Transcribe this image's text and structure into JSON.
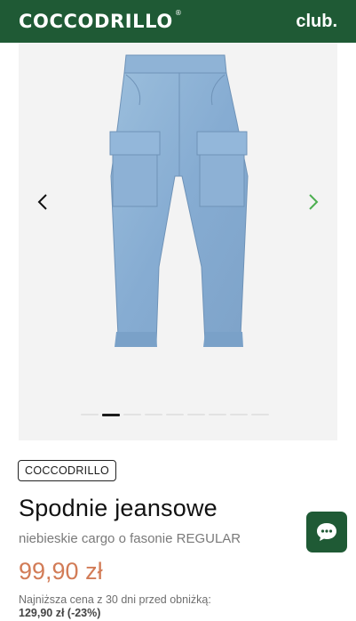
{
  "header": {
    "logo": "COCCODRILLO",
    "logo_mark": "®",
    "club": "club."
  },
  "gallery": {
    "slide_count": 9,
    "active_index": 1
  },
  "product": {
    "brand": "COCCODRILLO",
    "title": "Spodnie jeansowe",
    "subtitle": "niebieskie cargo o fasonie REGULAR",
    "price": "99,90 zł",
    "lowest_price_label": "Najniższa cena z 30 dni przed obniżką:",
    "lowest_price_value": "129,90 zł (-23%)"
  },
  "colors": {
    "brand_green": "#1f5a35",
    "price": "#d27c57",
    "arrow_right": "#4caf50"
  },
  "icons": {
    "prev": "chevron-left-icon",
    "next": "chevron-right-icon",
    "chat": "chat-bubble-icon"
  }
}
